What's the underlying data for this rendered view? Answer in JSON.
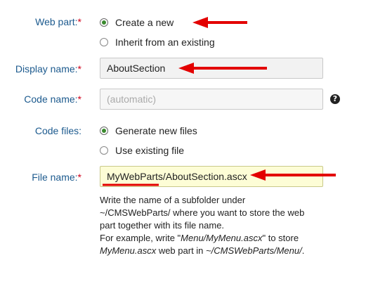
{
  "web_part": {
    "label": "Web part:",
    "required_mark": "*",
    "options": [
      "Create a new",
      "Inherit from an existing"
    ],
    "selected_index": 0
  },
  "display_name": {
    "label": "Display name:",
    "required_mark": "*",
    "value": "AboutSection"
  },
  "code_name": {
    "label": "Code name:",
    "required_mark": "*",
    "placeholder": "(automatic)",
    "help_icon": "?"
  },
  "code_files": {
    "label": "Code files:",
    "options": [
      "Generate new files",
      "Use existing file"
    ],
    "selected_index": 0
  },
  "file_name": {
    "label": "File name:",
    "required_mark": "*",
    "value": "MyWebParts/AboutSection.ascx"
  },
  "description": {
    "line1": "Write the name of a subfolder under",
    "line2": "~/CMSWebParts/ where you want to store the web",
    "line3": "part together with its file name.",
    "example_prefix": "For example, write \"",
    "example_file": "Menu/MyMenu.ascx",
    "example_mid": "\" to store",
    "example_name": "MyMenu.ascx",
    "example_mid2": " web part in ",
    "example_path": "~/CMSWebParts/Menu/",
    "example_end": "."
  },
  "colors": {
    "label": "#1c5a8e",
    "required": "#d0021b",
    "radio_checked": "#3a8a2e",
    "annotation_arrow": "#e30000",
    "highlight_field": "#fdfdd6"
  }
}
